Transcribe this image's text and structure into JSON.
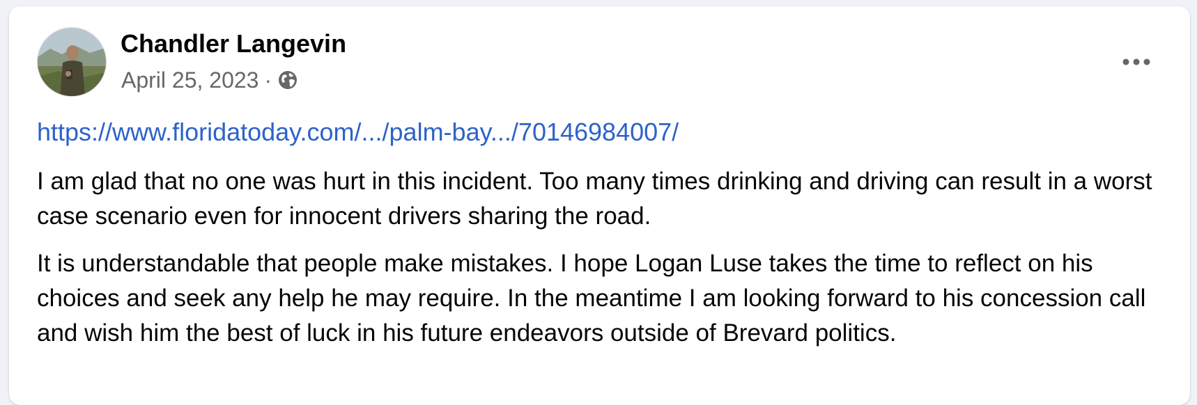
{
  "post": {
    "author": "Chandler Langevin",
    "date": "April 25, 2023",
    "separator": "·",
    "privacy_icon": "globe-icon",
    "menu_icon": "more-options-icon",
    "link": "https://www.floridatoday.com/.../palm-bay.../70146984007/",
    "paragraphs": [
      "I am glad that no one was hurt in this incident. Too many times drinking and driving can result in a worst case scenario even for innocent drivers sharing the road.",
      "It is understandable that people make mistakes. I hope Logan Luse takes the time to reflect on his choices and seek any help he may require. In the meantime I am looking forward to his concession call and wish him the best of luck in his future endeavors outside of Brevard politics."
    ]
  },
  "colors": {
    "link": "#2d62c9",
    "text": "#050505",
    "secondary_text": "#65676b",
    "background": "#f0f2f5",
    "card": "#ffffff"
  }
}
